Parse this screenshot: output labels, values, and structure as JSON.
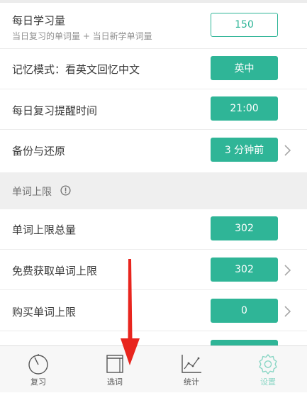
{
  "settings": {
    "daily_amount": {
      "label": "每日学习量",
      "sub": "当日复习的单词量 + 当日新学单词量",
      "value": "150"
    },
    "memory_mode": {
      "label": "记忆模式：看英文回忆中文",
      "value": "英中"
    },
    "reminder": {
      "label": "每日复习提醒时间",
      "value": "21:00"
    },
    "backup": {
      "label": "备份与还原",
      "value": "3 分钟前"
    }
  },
  "word_limit_section": {
    "title": "单词上限",
    "total": {
      "label": "单词上限总量",
      "value": "302"
    },
    "free": {
      "label": "免费获取单词上限",
      "value": "302"
    },
    "buy": {
      "label": "购买单词上限",
      "value": "0"
    }
  },
  "tabs": [
    {
      "label": "复习",
      "icon": "stopwatch-icon"
    },
    {
      "label": "选词",
      "icon": "book-icon"
    },
    {
      "label": "统计",
      "icon": "line-chart-icon"
    },
    {
      "label": "设置",
      "icon": "gear-icon"
    }
  ],
  "colors": {
    "accent": "#2fb597",
    "active_tab": "#8ad6c5",
    "arrow": "#e8251e"
  }
}
